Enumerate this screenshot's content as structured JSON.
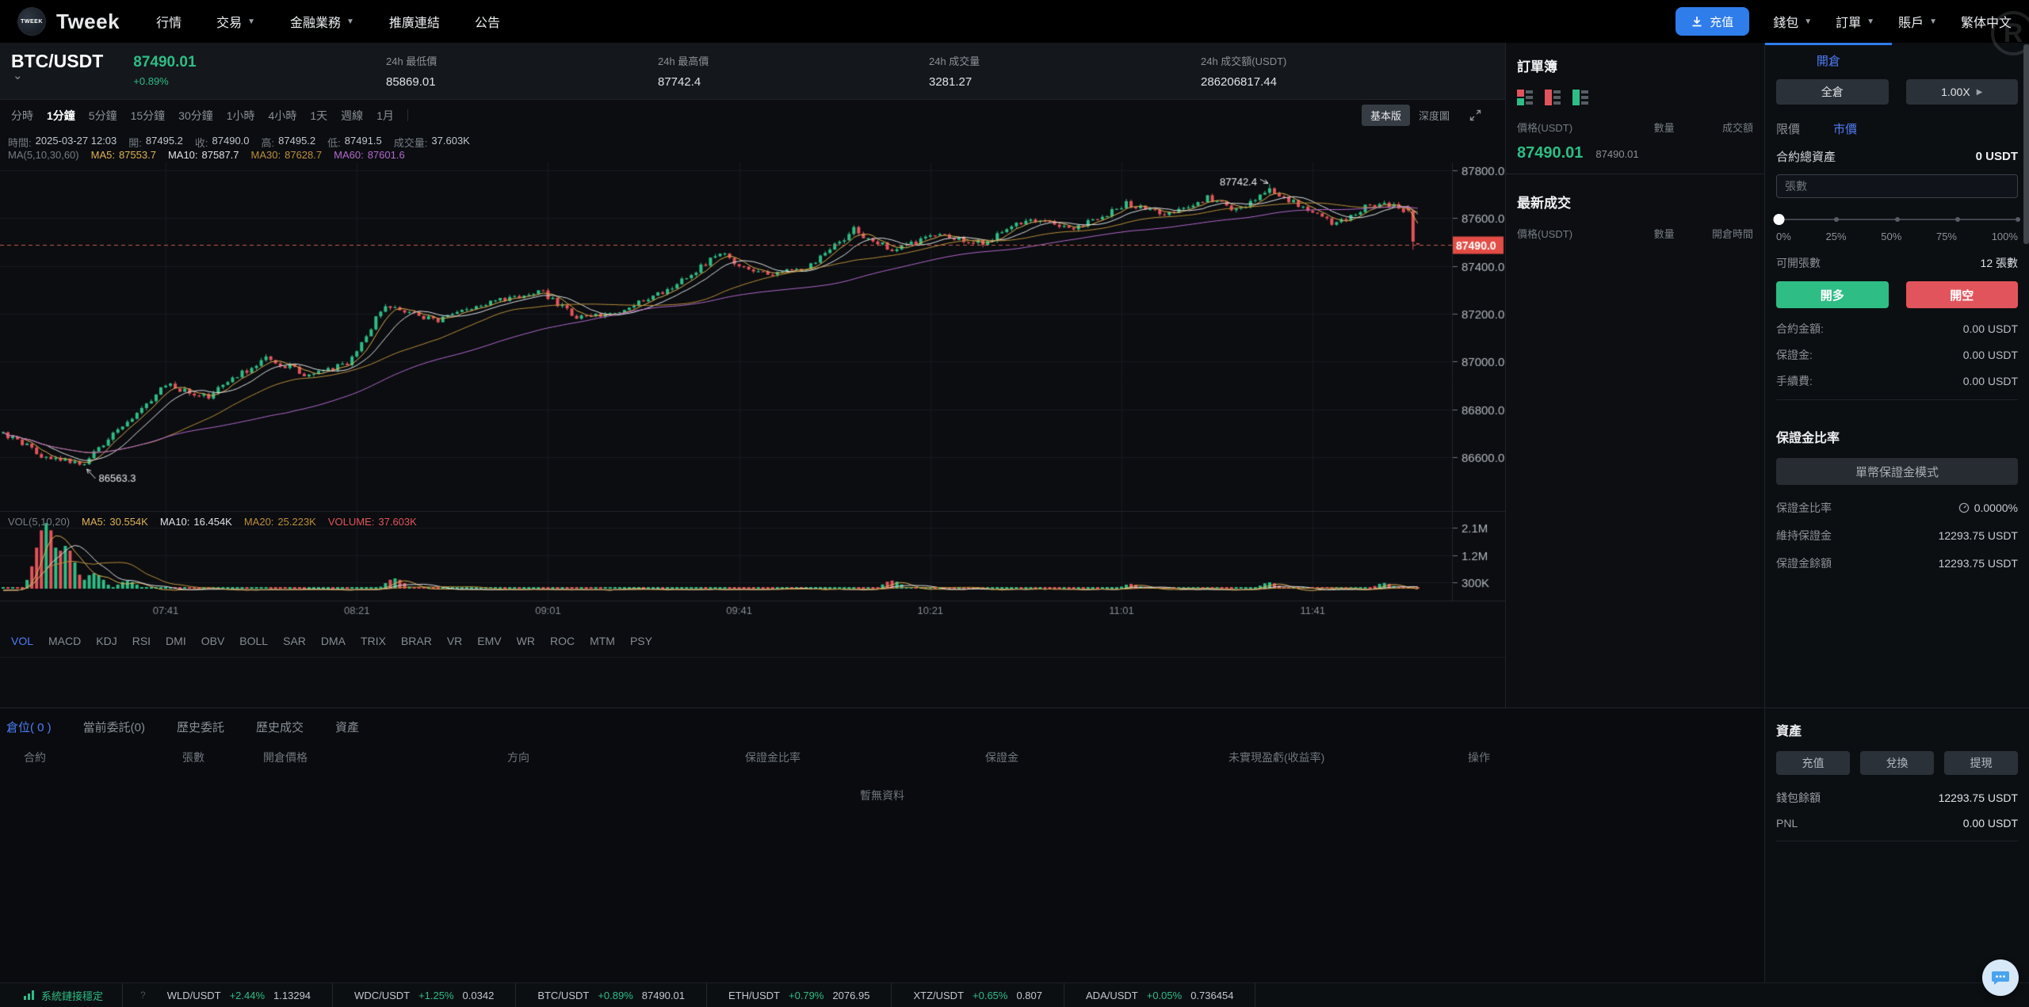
{
  "navbar": {
    "brand": "Tweek",
    "logo_text": "TWEEK",
    "menu": [
      {
        "label": "行情",
        "dropdown": false
      },
      {
        "label": "交易",
        "dropdown": true
      },
      {
        "label": "金融業務",
        "dropdown": true
      },
      {
        "label": "推廣連結",
        "dropdown": false
      },
      {
        "label": "公告",
        "dropdown": false
      }
    ],
    "deposit": "充值",
    "right_menu": [
      {
        "label": "錢包",
        "dropdown": true
      },
      {
        "label": "訂單",
        "dropdown": true
      },
      {
        "label": "賬戶",
        "dropdown": true
      },
      {
        "label": "繁体中文",
        "dropdown": false
      }
    ]
  },
  "ticker": {
    "symbol": "BTC/USDT",
    "price": "87490.01",
    "change": "+0.89%",
    "stats": [
      {
        "label": "24h 最低價",
        "value": "85869.01"
      },
      {
        "label": "24h 最高價",
        "value": "87742.4"
      },
      {
        "label": "24h 成交量",
        "value": "3281.27"
      },
      {
        "label": "24h 成交額(USDT)",
        "value": "286206817.44"
      }
    ]
  },
  "toolbar": {
    "timeframes": [
      "分時",
      "1分鐘",
      "5分鐘",
      "15分鐘",
      "30分鐘",
      "1小時",
      "4小時",
      "1天",
      "週線",
      "1月"
    ],
    "active_timeframe": "1分鐘",
    "views": [
      "基本版",
      "深度圖"
    ],
    "active_view": "基本版"
  },
  "chart_info": {
    "time_label": "時間:",
    "time": "2025-03-27 12:03",
    "open_label": "開:",
    "open": "87495.2",
    "close_label": "收:",
    "close": "87490.0",
    "high_label": "高:",
    "high": "87495.2",
    "low_label": "低:",
    "low": "87491.5",
    "vol_label": "成交量:",
    "vol": "37.603K",
    "ma_group": "MA(5,10,30,60)",
    "ma5_label": "MA5:",
    "ma5": "87553.7",
    "ma10_label": "MA10:",
    "ma10": "87587.7",
    "ma30_label": "MA30:",
    "ma30": "87628.7",
    "ma60_label": "MA60:",
    "ma60": "87601.6"
  },
  "vol_info": {
    "group": "VOL(5,10,20)",
    "ma5_label": "MA5:",
    "ma5": "30.554K",
    "ma10_label": "MA10:",
    "ma10": "16.454K",
    "ma20_label": "MA20:",
    "ma20": "25.223K",
    "volume_label": "VOLUME:",
    "volume": "37.603K"
  },
  "indicators": {
    "active": "VOL",
    "items": [
      "VOL",
      "MACD",
      "KDJ",
      "RSI",
      "DMI",
      "OBV",
      "BOLL",
      "SAR",
      "DMA",
      "TRIX",
      "BRAR",
      "VR",
      "EMV",
      "WR",
      "ROC",
      "MTM",
      "PSY"
    ]
  },
  "chart_data": {
    "type": "candlestick",
    "interval_minutes": 1,
    "minutes_total": 296,
    "price_axis": {
      "ticks": [
        87800,
        87600,
        87400,
        87200,
        87000,
        86800,
        86600
      ]
    },
    "volume_axis": [
      {
        "label": "2.1M",
        "value": 2100000
      },
      {
        "label": "1.2M",
        "value": 1200000
      },
      {
        "label": "300K",
        "value": 300000
      }
    ],
    "time_ticks": [
      {
        "label": "07:41",
        "minute": 34
      },
      {
        "label": "08:21",
        "minute": 74
      },
      {
        "label": "09:01",
        "minute": 114
      },
      {
        "label": "09:41",
        "minute": 154
      },
      {
        "label": "10:21",
        "minute": 194
      },
      {
        "label": "11:01",
        "minute": 234
      },
      {
        "label": "11:41",
        "minute": 274
      }
    ],
    "current_price": 87490.0,
    "current_price_label": "87490.0",
    "high_annotation": {
      "label": "87742.4",
      "minute": 265,
      "price": 87742.4
    },
    "low_annotation": {
      "label": "86563.3",
      "minute": 17,
      "price": 86563.3
    },
    "last_candle": {
      "open": 87495.2,
      "high": 87495.2,
      "low": 87491.5,
      "close": 87490.0,
      "volume": 37603
    },
    "price_anchors": [
      [
        0,
        86700
      ],
      [
        8,
        86610
      ],
      [
        17,
        86575
      ],
      [
        25,
        86730
      ],
      [
        34,
        86900
      ],
      [
        43,
        86855
      ],
      [
        55,
        87020
      ],
      [
        63,
        86950
      ],
      [
        72,
        86990
      ],
      [
        80,
        87240
      ],
      [
        90,
        87170
      ],
      [
        100,
        87230
      ],
      [
        112,
        87300
      ],
      [
        120,
        87185
      ],
      [
        130,
        87215
      ],
      [
        140,
        87310
      ],
      [
        150,
        87450
      ],
      [
        158,
        87365
      ],
      [
        168,
        87395
      ],
      [
        178,
        87550
      ],
      [
        186,
        87465
      ],
      [
        196,
        87530
      ],
      [
        205,
        87495
      ],
      [
        215,
        87600
      ],
      [
        225,
        87560
      ],
      [
        235,
        87660
      ],
      [
        243,
        87615
      ],
      [
        252,
        87685
      ],
      [
        258,
        87635
      ],
      [
        265,
        87720
      ],
      [
        272,
        87645
      ],
      [
        279,
        87575
      ],
      [
        286,
        87660
      ],
      [
        291,
        87648
      ],
      [
        293,
        87630
      ],
      [
        294,
        87560
      ],
      [
        295,
        87500
      ],
      [
        296,
        87490
      ]
    ],
    "volume_spikes": [
      [
        9,
        2250000
      ],
      [
        13,
        1500000
      ],
      [
        19,
        600000
      ],
      [
        26,
        350000
      ],
      [
        82,
        430000
      ],
      [
        186,
        360000
      ],
      [
        236,
        250000
      ],
      [
        265,
        300000
      ],
      [
        289,
        280000
      ]
    ],
    "seed": 11
  },
  "order_book": {
    "title": "訂單簿",
    "columns": [
      "價格(USDT)",
      "數量",
      "成交額"
    ],
    "last_price": "87490.01",
    "index_price": "87490.01",
    "trades_title": "最新成交",
    "trades_columns": [
      "價格(USDT)",
      "數量",
      "開倉時間"
    ]
  },
  "trade_panel": {
    "tab": "開倉",
    "margin_mode": "全倉",
    "leverage": "1.00X",
    "order_types": [
      "限價",
      "市價"
    ],
    "active_order_type": "市價",
    "total_assets_label": "合約總資產",
    "total_assets": "0 USDT",
    "qty_placeholder": "張數",
    "slider_marks": [
      "0%",
      "25%",
      "50%",
      "75%",
      "100%"
    ],
    "available_label": "可開張數",
    "available": "12 張數",
    "open_long": "開多",
    "open_short": "開空",
    "rows": [
      {
        "label": "合約金額:",
        "value": "0.00 USDT"
      },
      {
        "label": "保證金:",
        "value": "0.00 USDT"
      },
      {
        "label": "手續費:",
        "value": "0.00 USDT"
      }
    ],
    "margin_section_title": "保證金比率",
    "margin_mode_button": "單幣保證金模式",
    "margin_rows": [
      {
        "label": "保證金比率",
        "value": "0.0000%"
      },
      {
        "label": "維持保證金",
        "value": "12293.75 USDT"
      },
      {
        "label": "保證金餘額",
        "value": "12293.75 USDT"
      }
    ]
  },
  "positions": {
    "tabs": [
      "倉位( 0 )",
      "當前委託(0)",
      "歷史委託",
      "歷史成交",
      "資產"
    ],
    "active_tab": "倉位( 0 )",
    "columns": [
      "合約",
      "張數",
      "開倉價格",
      "方向",
      "保證金比率",
      "保證金",
      "未實現盈虧(收益率)",
      "操作"
    ],
    "empty": "暫無資料"
  },
  "assets": {
    "title": "資產",
    "buttons": [
      "充值",
      "兌換",
      "提現"
    ],
    "rows": [
      {
        "label": "錢包餘額",
        "value": "12293.75 USDT"
      },
      {
        "label": "PNL",
        "value": "0.00 USDT"
      }
    ]
  },
  "status_bar": {
    "connection": "系統鏈接穩定",
    "hint": "?",
    "tickers": [
      {
        "pair": "WLD/USDT",
        "change": "+2.44%",
        "price": "1.13294"
      },
      {
        "pair": "WDC/USDT",
        "change": "+1.25%",
        "price": "0.0342"
      },
      {
        "pair": "BTC/USDT",
        "change": "+0.89%",
        "price": "87490.01"
      },
      {
        "pair": "ETH/USDT",
        "change": "+0.79%",
        "price": "2076.95"
      },
      {
        "pair": "XTZ/USDT",
        "change": "+0.65%",
        "price": "0.807"
      },
      {
        "pair": "ADA/USDT",
        "change": "+0.05%",
        "price": "0.736454"
      }
    ]
  },
  "colors": {
    "green": "#2ebd85",
    "red": "#e2545b",
    "blue": "#2f7ceb",
    "tab_blue": "#4f7df9",
    "ma5": "#e0b154",
    "ma10": "#dfe2e6",
    "ma30": "#bd8e3a",
    "ma60": "#b468cf"
  }
}
